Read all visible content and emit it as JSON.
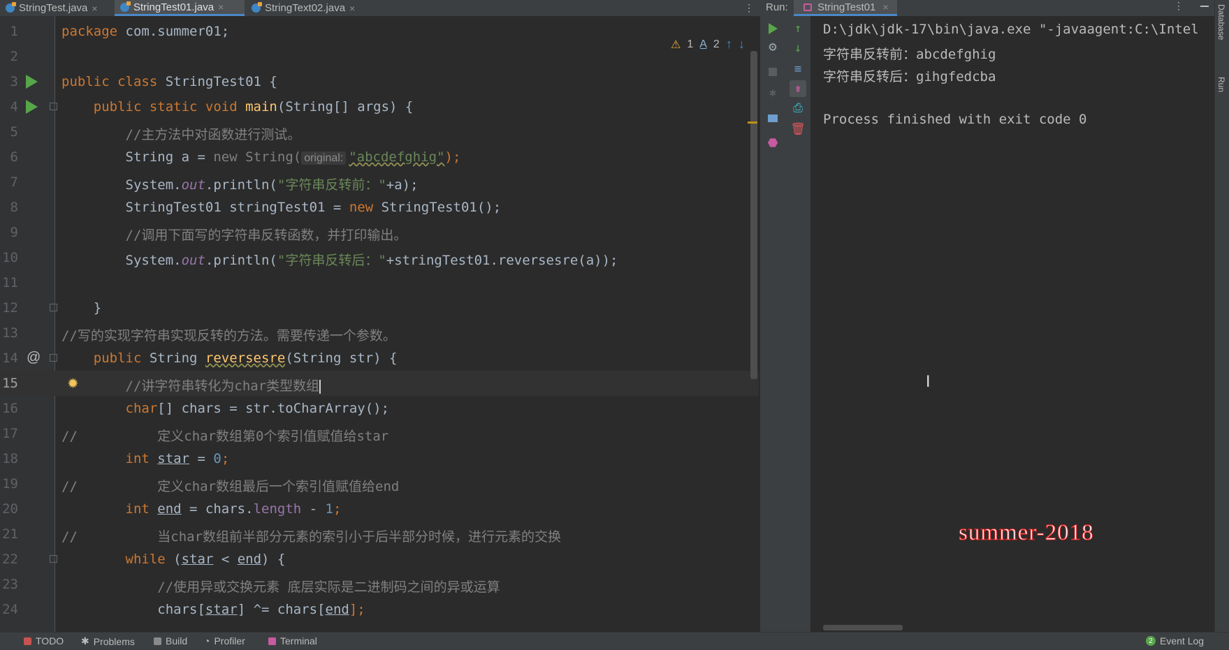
{
  "tabs": [
    {
      "label": "StringTest.java",
      "active": false
    },
    {
      "label": "StringTest01.java",
      "active": true
    },
    {
      "label": "StringText02.java",
      "active": false
    }
  ],
  "close_glyph": "×",
  "menu_glyph": "⋮",
  "inspection": {
    "warnings": "1",
    "weak_warnings": "2"
  },
  "editor": {
    "lines": [
      {
        "num": "1"
      },
      {
        "num": "2"
      },
      {
        "num": "3"
      },
      {
        "num": "4"
      },
      {
        "num": "5"
      },
      {
        "num": "6"
      },
      {
        "num": "7"
      },
      {
        "num": "8"
      },
      {
        "num": "9"
      },
      {
        "num": "10"
      },
      {
        "num": "11"
      },
      {
        "num": "12"
      },
      {
        "num": "13"
      },
      {
        "num": "14"
      },
      {
        "num": "15"
      },
      {
        "num": "16"
      },
      {
        "num": "17"
      },
      {
        "num": "18"
      },
      {
        "num": "19"
      },
      {
        "num": "20"
      },
      {
        "num": "21"
      },
      {
        "num": "22"
      },
      {
        "num": "23"
      },
      {
        "num": "24"
      }
    ],
    "code": {
      "package_kw": "package ",
      "package_name": "com.summer01;",
      "l3_kw": "public class ",
      "l3_rest": "StringTest01 {",
      "l4_kw": "public static void ",
      "l4_fn": "main",
      "l4_rest": "(String[] args) {",
      "l5": "//主方法中对函数进行测试。",
      "l6_a": "String a = ",
      "l6_new": "new ",
      "l6_b": "String(",
      "l6_hint": "original:",
      "l6_str": "\"abcdefghig\"",
      "l6_end": ");",
      "sys": "System.",
      "out": "out",
      "println": ".println(",
      "l7_str": "\"字符串反转前：\"",
      "l7_end": "+a);",
      "l8_a": "StringTest01 stringTest01 = ",
      "l8_new": "new ",
      "l8_b": "StringTest01();",
      "l9": "//调用下面写的字符串反转函数，并打印输出。",
      "l10_str": "\"字符串反转后：\"",
      "l10_end": "+stringTest01.reversesre(a));",
      "l12": "}",
      "l13": "//写的实现字符串实现反转的方法。需要传递一个参数。",
      "l14_kw": "public ",
      "l14_a": "String ",
      "l14_fn": "reversesre",
      "l14_rest": "(String str) {",
      "l15": "//讲字符串转化为char类型数组",
      "l16_kw": "char",
      "l16_rest": "[] chars = str.toCharArray();",
      "slashes": "//",
      "l17": "定义char数组第0个索引值赋值给star",
      "int_kw": "int ",
      "star": "star",
      "l18_eq": " = ",
      "zero": "0",
      "semi": ";",
      "l19": "定义char数组最后一个索引值赋值给end",
      "end": "end",
      "l20_mid": " = chars.",
      "length": "length",
      "minus": " - ",
      "one": "1",
      "l21": "当char数组前半部分元素的索引小于后半部分时候，进行元素的交换",
      "while_kw": "while ",
      "lparen": "(",
      "lt": " < ",
      "l22_end": ") {",
      "l23": "//使用异或交换元素 底层实际是二进制码之间的异或运算",
      "chars_lb": "chars[",
      "l24_mid": "] ^= chars[",
      "l24_end": "];"
    }
  },
  "run": {
    "label": "Run:",
    "tab": "StringTest01",
    "console": [
      "D:\\jdk\\jdk-17\\bin\\java.exe \"-javaagent:C:\\Intel",
      "字符串反转前：abcdefghig",
      "字符串反转后：gihgfedcba",
      "",
      "Process finished with exit code 0"
    ],
    "watermark": "summer-2018"
  },
  "side": {
    "database": "Database",
    "run": "Run"
  },
  "statusbar": {
    "todo": "TODO",
    "problems": "Problems",
    "build": "Build",
    "profiler": "Profiler",
    "terminal": "Terminal",
    "event_log": "Event Log",
    "event_count": "2"
  },
  "colors": {
    "accent": "#4a88c7",
    "run_green": "#57a64a",
    "keyword": "#cc7832",
    "string": "#6a8759",
    "comment": "#808080"
  }
}
